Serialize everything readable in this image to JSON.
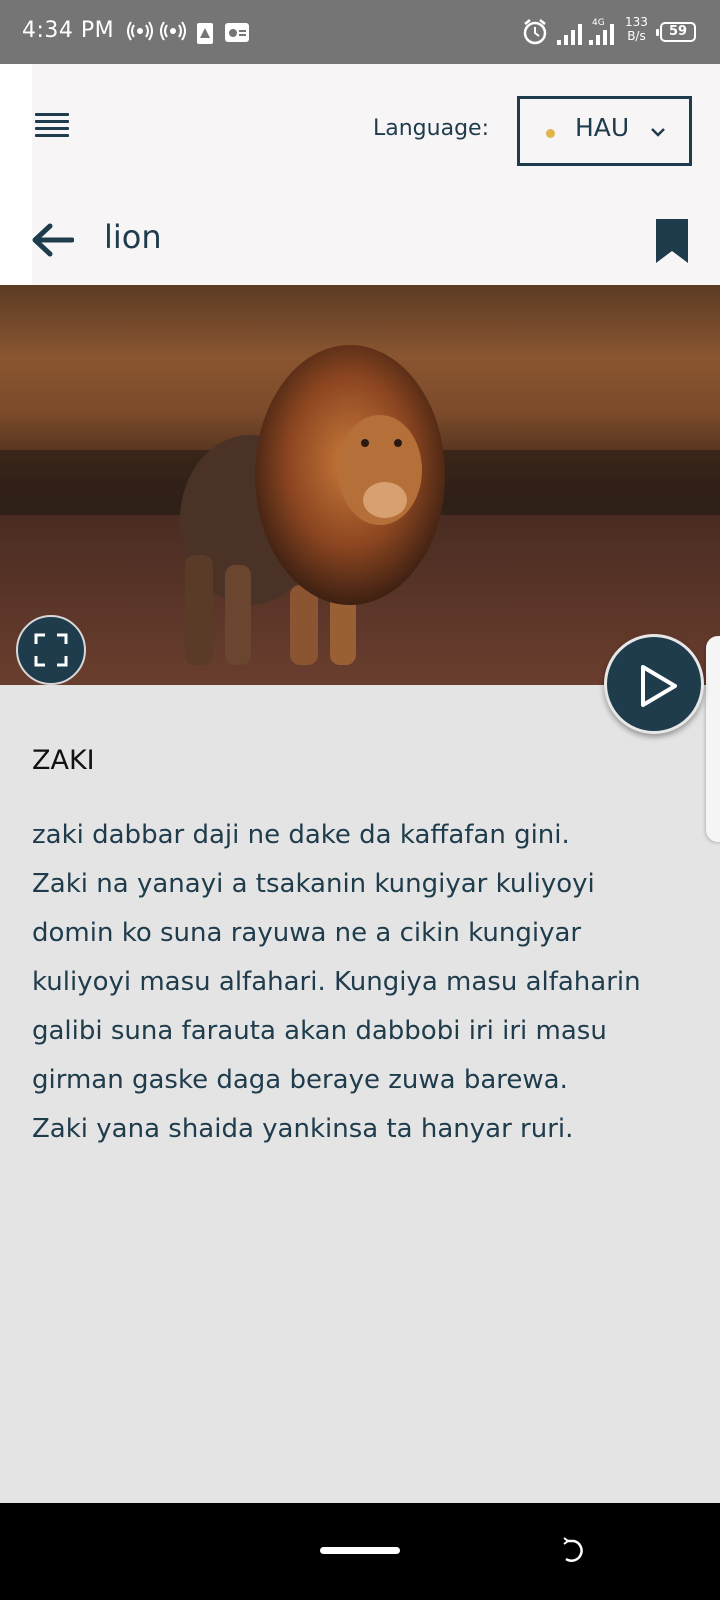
{
  "status_bar": {
    "time": "4:34 PM",
    "network_speed_value": "133",
    "network_speed_unit": "B/s",
    "network_type": "4G",
    "battery": "59"
  },
  "header": {
    "language_label": "Language:",
    "language_value": "HAU",
    "title": "lion"
  },
  "content": {
    "heading": "ZAKI",
    "paragraph_lines": [
      "zaki dabbar daji ne dake da kaffafan gini.",
      "Zaki na yanayi a tsakanin kungiyar kuliyoyi",
      "domin ko suna rayuwa ne a cikin kungiyar",
      "kuliyoyi masu alfahari. Kungiya masu alfaharin",
      "galibi suna farauta akan dabbobi iri iri masu",
      "girman gaske daga beraye zuwa barewa.",
      "Zaki yana shaida yankinsa ta hanyar ruri."
    ]
  },
  "icons": {
    "menu": "menu-icon",
    "back": "back-arrow-icon",
    "bookmark": "bookmark-icon",
    "fullscreen": "fullscreen-icon",
    "play": "play-icon",
    "chevron": "chevron-down-icon"
  },
  "colors": {
    "primary": "#1f3c4c",
    "accent_dot": "#e0b64b",
    "background": "#e4e4e4",
    "header_bg": "#f7f5f6"
  }
}
